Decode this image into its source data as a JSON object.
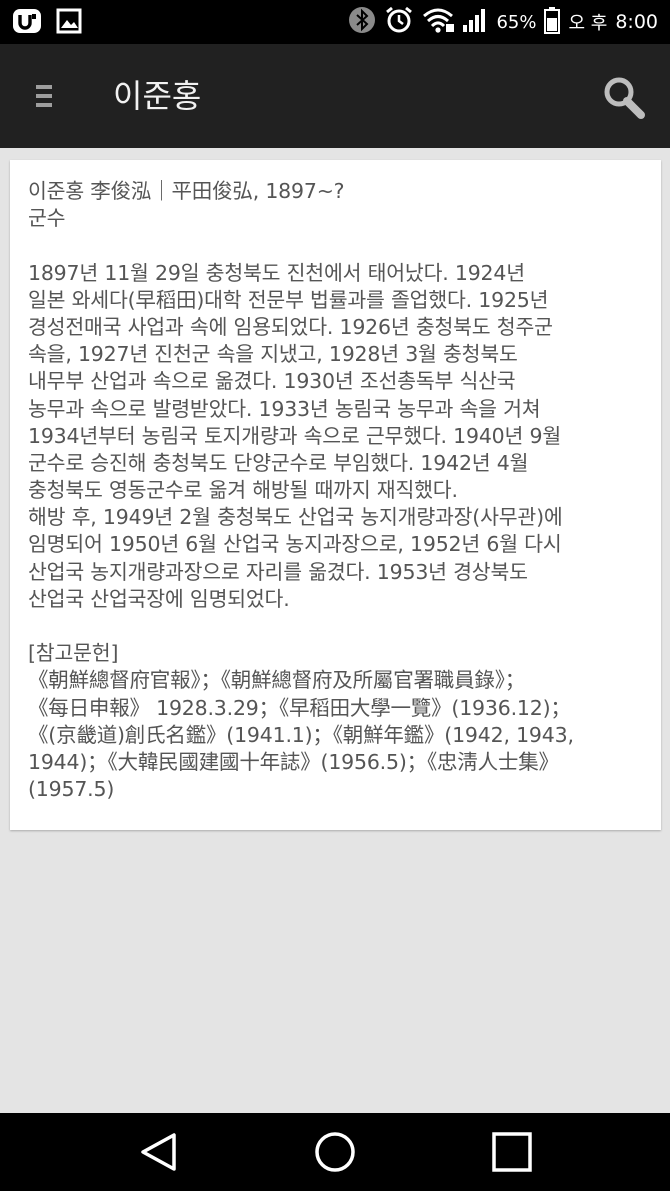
{
  "status_bar": {
    "icons": [
      "carrier-u-icon",
      "gallery-icon",
      "bluetooth-icon",
      "alarm-icon",
      "wifi-icon",
      "signal-icon",
      "battery-icon"
    ],
    "battery": "65%",
    "ampm": "오 후",
    "time": "8:00"
  },
  "app_bar": {
    "menu_icon": "hamburger-menu-icon",
    "title": "이준홍",
    "search_icon": "search-icon"
  },
  "entry": {
    "heading_lines": [
      "이준홍 李俊泓｜平田俊弘, 1897~?",
      "군수"
    ],
    "body_lines": [
      "1897년 11월 29일 충청북도 진천에서 태어났다. 1924년",
      "일본 와세다(早稻田)대학 전문부 법률과를 졸업했다. 1925년",
      "경성전매국 사업과 속에 임용되었다. 1926년 충청북도 청주군",
      "속을, 1927년 진천군 속을 지냈고, 1928년 3월 충청북도",
      "내무부 산업과 속으로 옮겼다. 1930년 조선총독부 식산국",
      "농무과 속으로 발령받았다. 1933년 농림국 농무과 속을 거쳐",
      "1934년부터 농림국 토지개량과 속으로 근무했다. 1940년 9월",
      "군수로 승진해 충청북도 단양군수로 부임했다. 1942년 4월",
      "충청북도 영동군수로 옮겨 해방될 때까지 재직했다.",
      "해방 후, 1949년 2월 충청북도 산업국 농지개량과장(사무관)에",
      "임명되어 1950년 6월 산업국 농지과장으로, 1952년 6월 다시",
      "산업국 농지개량과장으로 자리를 옮겼다. 1953년 경상북도",
      "산업국 산업국장에 임명되었다."
    ],
    "ref_title": "[참고문헌]",
    "ref_lines": [
      "《朝鮮總督府官報》；《朝鮮總督府及所屬官署職員錄》；",
      "《每日申報》 1928.3.29；《早稻田大學一覽》(1936.12)；",
      "《(京畿道)創氏名鑑》(1941.1)；《朝鮮年鑑》(1942, 1943,",
      "1944)；《大韓民國建國十年誌》(1956.5)；《忠淸人士集》",
      "(1957.5)"
    ]
  },
  "nav_bar": {
    "back_icon": "back-triangle-icon",
    "home_icon": "home-circle-icon",
    "recents_icon": "recents-square-icon"
  }
}
